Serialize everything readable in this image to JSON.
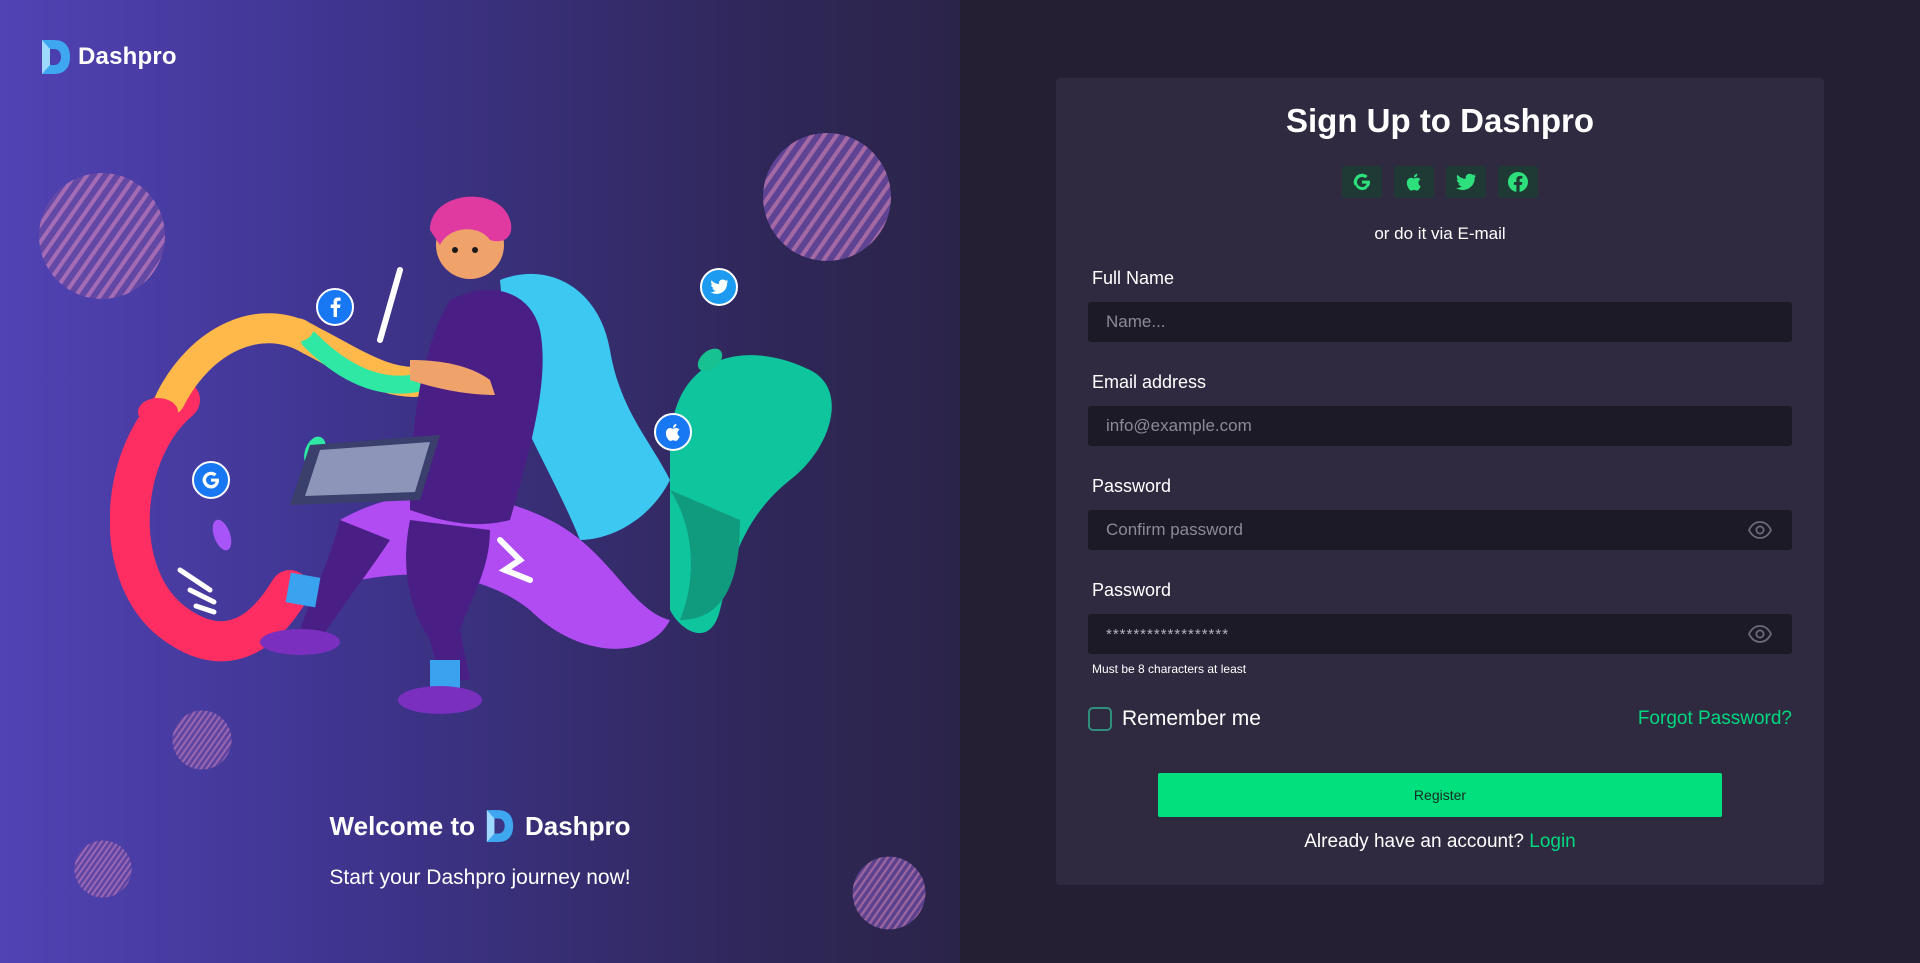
{
  "brand": {
    "name": "Dashpro"
  },
  "welcome": {
    "prefix": "Welcome to",
    "brand": "Dashpro",
    "tagline": "Start your Dashpro journey now!"
  },
  "signup": {
    "title": "Sign Up to Dashpro",
    "social_icons": [
      "google-icon",
      "apple-icon",
      "twitter-icon",
      "facebook-icon"
    ],
    "via_text": "or do it via E-mail",
    "fields": [
      {
        "label": "Full Name",
        "placeholder": "Name..."
      },
      {
        "label": "Email address",
        "placeholder": "info@example.com"
      },
      {
        "label": "Password",
        "placeholder": "Confirm password"
      },
      {
        "label": "Password",
        "value": "******************"
      }
    ],
    "password_hint": "Must be 8 characters at least",
    "remember_label": "Remember me",
    "forgot_label": "Forgot Password?",
    "register_label": "Register",
    "login_prompt": "Already have an account?",
    "login_link": "Login"
  },
  "colors": {
    "accent": "#00e07c",
    "panel": "#2f2a40",
    "background": "#251f33",
    "left_gradient_start": "#5143b4"
  }
}
